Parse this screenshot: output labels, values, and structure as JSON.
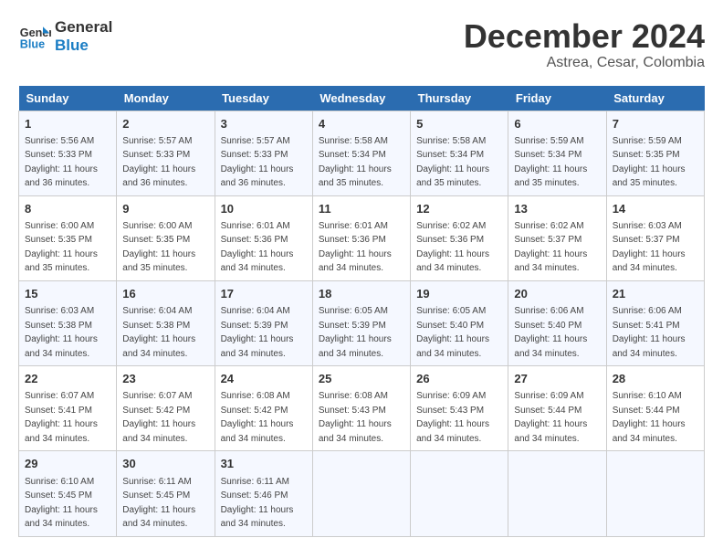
{
  "header": {
    "logo_line1": "General",
    "logo_line2": "Blue",
    "month": "December 2024",
    "location": "Astrea, Cesar, Colombia"
  },
  "days_of_week": [
    "Sunday",
    "Monday",
    "Tuesday",
    "Wednesday",
    "Thursday",
    "Friday",
    "Saturday"
  ],
  "weeks": [
    [
      {
        "num": "1",
        "rise": "5:56 AM",
        "set": "5:33 PM",
        "daylight": "11 hours and 36 minutes."
      },
      {
        "num": "2",
        "rise": "5:57 AM",
        "set": "5:33 PM",
        "daylight": "11 hours and 36 minutes."
      },
      {
        "num": "3",
        "rise": "5:57 AM",
        "set": "5:33 PM",
        "daylight": "11 hours and 36 minutes."
      },
      {
        "num": "4",
        "rise": "5:58 AM",
        "set": "5:34 PM",
        "daylight": "11 hours and 35 minutes."
      },
      {
        "num": "5",
        "rise": "5:58 AM",
        "set": "5:34 PM",
        "daylight": "11 hours and 35 minutes."
      },
      {
        "num": "6",
        "rise": "5:59 AM",
        "set": "5:34 PM",
        "daylight": "11 hours and 35 minutes."
      },
      {
        "num": "7",
        "rise": "5:59 AM",
        "set": "5:35 PM",
        "daylight": "11 hours and 35 minutes."
      }
    ],
    [
      {
        "num": "8",
        "rise": "6:00 AM",
        "set": "5:35 PM",
        "daylight": "11 hours and 35 minutes."
      },
      {
        "num": "9",
        "rise": "6:00 AM",
        "set": "5:35 PM",
        "daylight": "11 hours and 35 minutes."
      },
      {
        "num": "10",
        "rise": "6:01 AM",
        "set": "5:36 PM",
        "daylight": "11 hours and 34 minutes."
      },
      {
        "num": "11",
        "rise": "6:01 AM",
        "set": "5:36 PM",
        "daylight": "11 hours and 34 minutes."
      },
      {
        "num": "12",
        "rise": "6:02 AM",
        "set": "5:36 PM",
        "daylight": "11 hours and 34 minutes."
      },
      {
        "num": "13",
        "rise": "6:02 AM",
        "set": "5:37 PM",
        "daylight": "11 hours and 34 minutes."
      },
      {
        "num": "14",
        "rise": "6:03 AM",
        "set": "5:37 PM",
        "daylight": "11 hours and 34 minutes."
      }
    ],
    [
      {
        "num": "15",
        "rise": "6:03 AM",
        "set": "5:38 PM",
        "daylight": "11 hours and 34 minutes."
      },
      {
        "num": "16",
        "rise": "6:04 AM",
        "set": "5:38 PM",
        "daylight": "11 hours and 34 minutes."
      },
      {
        "num": "17",
        "rise": "6:04 AM",
        "set": "5:39 PM",
        "daylight": "11 hours and 34 minutes."
      },
      {
        "num": "18",
        "rise": "6:05 AM",
        "set": "5:39 PM",
        "daylight": "11 hours and 34 minutes."
      },
      {
        "num": "19",
        "rise": "6:05 AM",
        "set": "5:40 PM",
        "daylight": "11 hours and 34 minutes."
      },
      {
        "num": "20",
        "rise": "6:06 AM",
        "set": "5:40 PM",
        "daylight": "11 hours and 34 minutes."
      },
      {
        "num": "21",
        "rise": "6:06 AM",
        "set": "5:41 PM",
        "daylight": "11 hours and 34 minutes."
      }
    ],
    [
      {
        "num": "22",
        "rise": "6:07 AM",
        "set": "5:41 PM",
        "daylight": "11 hours and 34 minutes."
      },
      {
        "num": "23",
        "rise": "6:07 AM",
        "set": "5:42 PM",
        "daylight": "11 hours and 34 minutes."
      },
      {
        "num": "24",
        "rise": "6:08 AM",
        "set": "5:42 PM",
        "daylight": "11 hours and 34 minutes."
      },
      {
        "num": "25",
        "rise": "6:08 AM",
        "set": "5:43 PM",
        "daylight": "11 hours and 34 minutes."
      },
      {
        "num": "26",
        "rise": "6:09 AM",
        "set": "5:43 PM",
        "daylight": "11 hours and 34 minutes."
      },
      {
        "num": "27",
        "rise": "6:09 AM",
        "set": "5:44 PM",
        "daylight": "11 hours and 34 minutes."
      },
      {
        "num": "28",
        "rise": "6:10 AM",
        "set": "5:44 PM",
        "daylight": "11 hours and 34 minutes."
      }
    ],
    [
      {
        "num": "29",
        "rise": "6:10 AM",
        "set": "5:45 PM",
        "daylight": "11 hours and 34 minutes."
      },
      {
        "num": "30",
        "rise": "6:11 AM",
        "set": "5:45 PM",
        "daylight": "11 hours and 34 minutes."
      },
      {
        "num": "31",
        "rise": "6:11 AM",
        "set": "5:46 PM",
        "daylight": "11 hours and 34 minutes."
      },
      null,
      null,
      null,
      null
    ]
  ],
  "labels": {
    "sunrise": "Sunrise: ",
    "sunset": "Sunset: ",
    "daylight": "Daylight: "
  }
}
